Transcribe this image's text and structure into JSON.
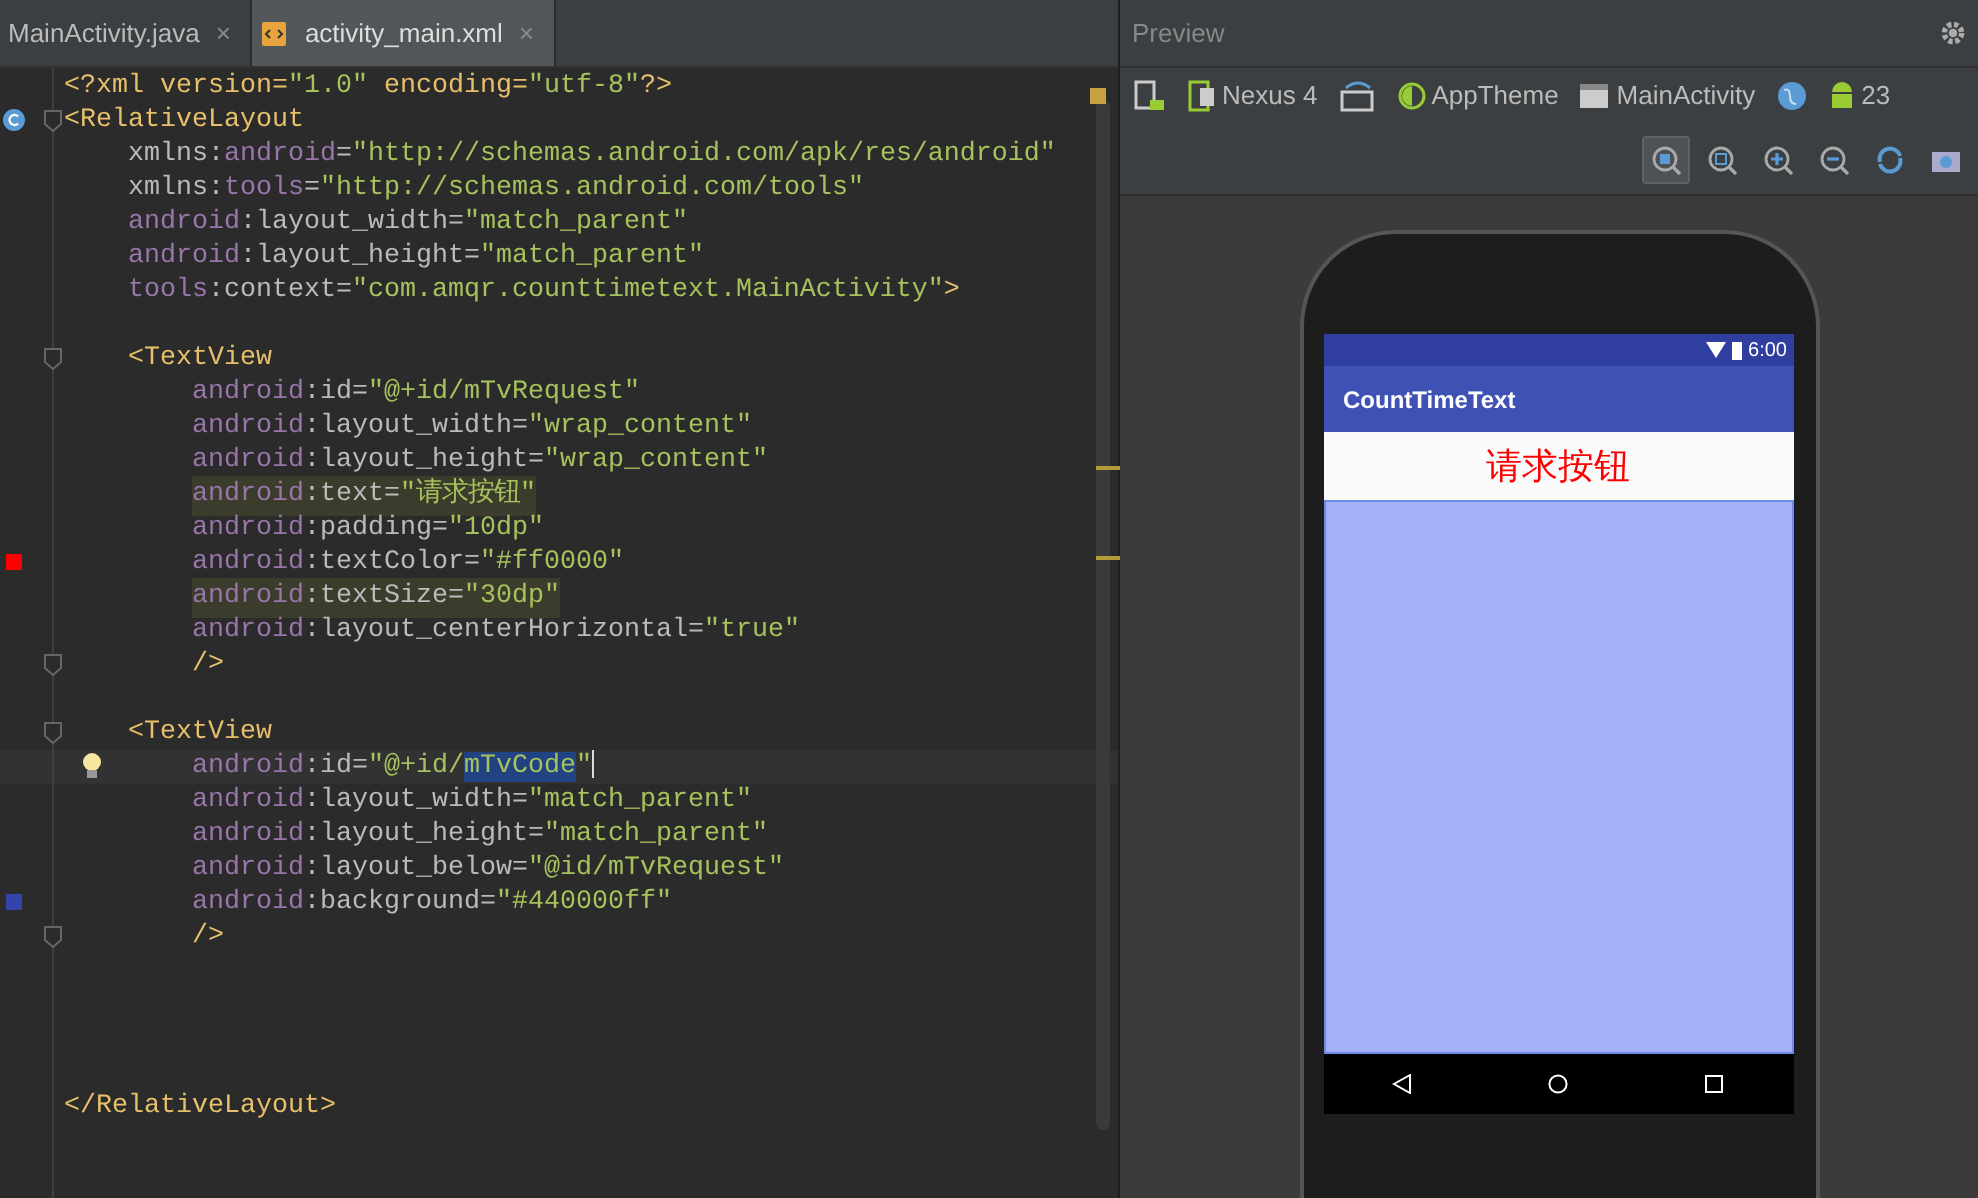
{
  "editor_tabs": [
    {
      "label": "MainActivity.java",
      "selected": false,
      "close": "×"
    },
    {
      "label": "activity_main.xml",
      "selected": true,
      "close": "×"
    }
  ],
  "code": [
    {
      "kind": "code",
      "segments": [
        {
          "text": "<?xml version=",
          "kind": "tag"
        },
        {
          "text": "\"1.0\"",
          "kind": "value"
        },
        {
          "text": " encoding=",
          "kind": "tag"
        },
        {
          "text": "\"utf-8\"",
          "kind": "value"
        },
        {
          "text": "?>",
          "kind": "tag"
        }
      ]
    },
    {
      "kind": "code",
      "class_marker": true,
      "fold": true,
      "segments": [
        {
          "text": "<RelativeLayout",
          "kind": "tag"
        }
      ],
      "children": [
        {
          "kind": "code",
          "segments": [
            {
              "text": "xmlns:",
              "kind": "attr"
            },
            {
              "text": "android",
              "kind": "ns"
            },
            {
              "text": "=",
              "kind": "attr"
            },
            {
              "text": "\"http://schemas.android.com/apk/res/android\"",
              "kind": "value"
            }
          ]
        },
        {
          "kind": "code",
          "segments": [
            {
              "text": "xmlns:",
              "kind": "attr"
            },
            {
              "text": "tools",
              "kind": "ns"
            },
            {
              "text": "=",
              "kind": "attr"
            },
            {
              "text": "\"http://schemas.android.com/tools\"",
              "kind": "value"
            }
          ]
        },
        {
          "kind": "code",
          "segments": [
            {
              "text": "android",
              "kind": "ns"
            },
            {
              "text": ":layout_width=",
              "kind": "attr"
            },
            {
              "text": "\"match_parent\"",
              "kind": "value"
            }
          ]
        },
        {
          "kind": "code",
          "segments": [
            {
              "text": "android",
              "kind": "ns"
            },
            {
              "text": ":layout_height=",
              "kind": "attr"
            },
            {
              "text": "\"match_parent\"",
              "kind": "value"
            }
          ]
        },
        {
          "kind": "code",
          "segments": [
            {
              "text": "tools",
              "kind": "ns"
            },
            {
              "text": ":context=",
              "kind": "attr"
            },
            {
              "text": "\"com.amqr.counttimetext.MainActivity\"",
              "kind": "value"
            },
            {
              "text": ">",
              "kind": "tag"
            }
          ]
        },
        {
          "kind": "blank"
        },
        {
          "kind": "code",
          "fold": true,
          "segments": [
            {
              "text": "<TextView",
              "kind": "tag"
            }
          ],
          "children": [
            {
              "kind": "code",
              "segments": [
                {
                  "text": "android",
                  "kind": "ns"
                },
                {
                  "text": ":id=",
                  "kind": "attr"
                },
                {
                  "text": "\"@+id/mTvRequest\"",
                  "kind": "value"
                }
              ]
            },
            {
              "kind": "code",
              "segments": [
                {
                  "text": "android",
                  "kind": "ns"
                },
                {
                  "text": ":layout_width=",
                  "kind": "attr"
                },
                {
                  "text": "\"wrap_content\"",
                  "kind": "value"
                }
              ]
            },
            {
              "kind": "code",
              "segments": [
                {
                  "text": "android",
                  "kind": "ns"
                },
                {
                  "text": ":layout_height=",
                  "kind": "attr"
                },
                {
                  "text": "\"wrap_content\"",
                  "kind": "value"
                }
              ]
            },
            {
              "kind": "code",
              "highlighted": true,
              "segments": [
                {
                  "text": "android",
                  "kind": "ns"
                },
                {
                  "text": ":text=",
                  "kind": "attr"
                },
                {
                  "text": "\"请求按钮\"",
                  "kind": "value"
                }
              ]
            },
            {
              "kind": "code",
              "segments": [
                {
                  "text": "android",
                  "kind": "ns"
                },
                {
                  "text": ":padding=",
                  "kind": "attr"
                },
                {
                  "text": "\"10dp\"",
                  "kind": "value"
                }
              ]
            },
            {
              "kind": "code",
              "color": "#ff0000",
              "segments": [
                {
                  "text": "android",
                  "kind": "ns"
                },
                {
                  "text": ":textColor=",
                  "kind": "attr"
                },
                {
                  "text": "\"#ff0000\"",
                  "kind": "value"
                }
              ]
            },
            {
              "kind": "code",
              "highlighted": true,
              "segments": [
                {
                  "text": "android",
                  "kind": "ns"
                },
                {
                  "text": ":textSize=",
                  "kind": "attr"
                },
                {
                  "text": "\"30dp\"",
                  "kind": "value"
                }
              ]
            },
            {
              "kind": "code",
              "segments": [
                {
                  "text": "android",
                  "kind": "ns"
                },
                {
                  "text": ":layout_centerHorizontal=",
                  "kind": "attr"
                },
                {
                  "text": "\"true\"",
                  "kind": "value"
                }
              ]
            },
            {
              "kind": "code",
              "fold": true,
              "segments": [
                {
                  "text": "/>",
                  "kind": "tag"
                }
              ]
            }
          ]
        },
        {
          "kind": "blank"
        },
        {
          "kind": "code",
          "fold": true,
          "segments": [
            {
              "text": "<TextView",
              "kind": "tag"
            }
          ],
          "children": [
            {
              "kind": "code",
              "current": true,
              "bulb": true,
              "segments": [
                {
                  "text": "android",
                  "kind": "ns"
                },
                {
                  "text": ":id=",
                  "kind": "attr"
                },
                {
                  "text": "\"@+id/",
                  "kind": "value"
                },
                {
                  "text": "mTvCode",
                  "kind": "selected"
                },
                {
                  "text": "\"",
                  "kind": "value"
                }
              ]
            },
            {
              "kind": "code",
              "segments": [
                {
                  "text": "android",
                  "kind": "ns"
                },
                {
                  "text": ":layout_width=",
                  "kind": "attr"
                },
                {
                  "text": "\"match_parent\"",
                  "kind": "value"
                }
              ]
            },
            {
              "kind": "code",
              "segments": [
                {
                  "text": "android",
                  "kind": "ns"
                },
                {
                  "text": ":layout_height=",
                  "kind": "attr"
                },
                {
                  "text": "\"match_parent\"",
                  "kind": "value"
                }
              ]
            },
            {
              "kind": "code",
              "segments": [
                {
                  "text": "android",
                  "kind": "ns"
                },
                {
                  "text": ":layout_below=",
                  "kind": "attr"
                },
                {
                  "text": "\"@id/mTvRequest\"",
                  "kind": "value"
                }
              ]
            },
            {
              "kind": "code",
              "color": "#3344aa",
              "segments": [
                {
                  "text": "android",
                  "kind": "ns"
                },
                {
                  "text": ":background=",
                  "kind": "attr"
                },
                {
                  "text": "\"#440000ff\"",
                  "kind": "value"
                }
              ]
            },
            {
              "kind": "code",
              "fold": true,
              "segments": [
                {
                  "text": "/>",
                  "kind": "tag"
                }
              ]
            }
          ]
        },
        {
          "kind": "blank"
        },
        {
          "kind": "blank"
        },
        {
          "kind": "blank"
        },
        {
          "kind": "blank"
        }
      ]
    },
    {
      "kind": "code",
      "segments": [
        {
          "text": "</RelativeLayout>",
          "kind": "tag"
        }
      ]
    }
  ],
  "preview": {
    "title": "Preview",
    "toolbar": [
      {
        "kind": "device-icon"
      },
      {
        "kind": "dropdown",
        "label": "Nexus 4"
      },
      {
        "kind": "orientation-icon"
      },
      {
        "kind": "theme",
        "label": "AppTheme"
      },
      {
        "kind": "activity",
        "label": "MainActivity"
      },
      {
        "kind": "globe-icon"
      },
      {
        "kind": "api",
        "label": "23"
      }
    ],
    "zoom_tools": [
      {
        "kind": "zoom-fit",
        "selected": true
      },
      {
        "kind": "zoom-actual",
        "selected": false
      },
      {
        "kind": "zoom-in",
        "selected": false
      },
      {
        "kind": "zoom-out",
        "selected": false
      },
      {
        "kind": "refresh",
        "selected": false
      },
      {
        "kind": "camera",
        "selected": false
      }
    ],
    "phone": {
      "time": "6:00",
      "app_title": "CountTimeText",
      "request_text": "请求按钮"
    }
  }
}
